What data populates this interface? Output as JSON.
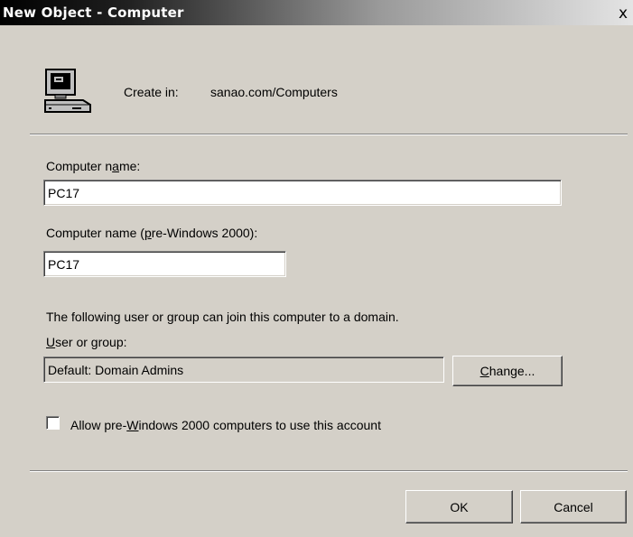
{
  "window": {
    "title": "New Object - Computer",
    "close_glyph": "x"
  },
  "header": {
    "icon": "computer-icon",
    "create_in_label": "Create in:",
    "create_in_value": "sanao.com/Computers"
  },
  "form": {
    "computer_name": {
      "label_before": "Computer n",
      "label_mnemonic": "a",
      "label_after": "me:",
      "value": "PC17"
    },
    "pre_win2000_name": {
      "label_before": "Computer name (",
      "label_mnemonic": "p",
      "label_after": "re-Windows 2000):",
      "value": "PC17"
    },
    "join_info": "The following user or group can join this computer to a domain.",
    "user_or_group": {
      "label_mnemonic": "U",
      "label_after": "ser or group:",
      "value": "Default: Domain Admins"
    },
    "change_button": {
      "mnemonic": "C",
      "label_after": "hange..."
    },
    "allow_pre_win2000": {
      "checked": false,
      "label_before": "Allow pre-",
      "label_mnemonic": "W",
      "label_after": "indows 2000 computers to use this account"
    }
  },
  "footer": {
    "ok_label": "OK",
    "cancel_label": "Cancel"
  }
}
